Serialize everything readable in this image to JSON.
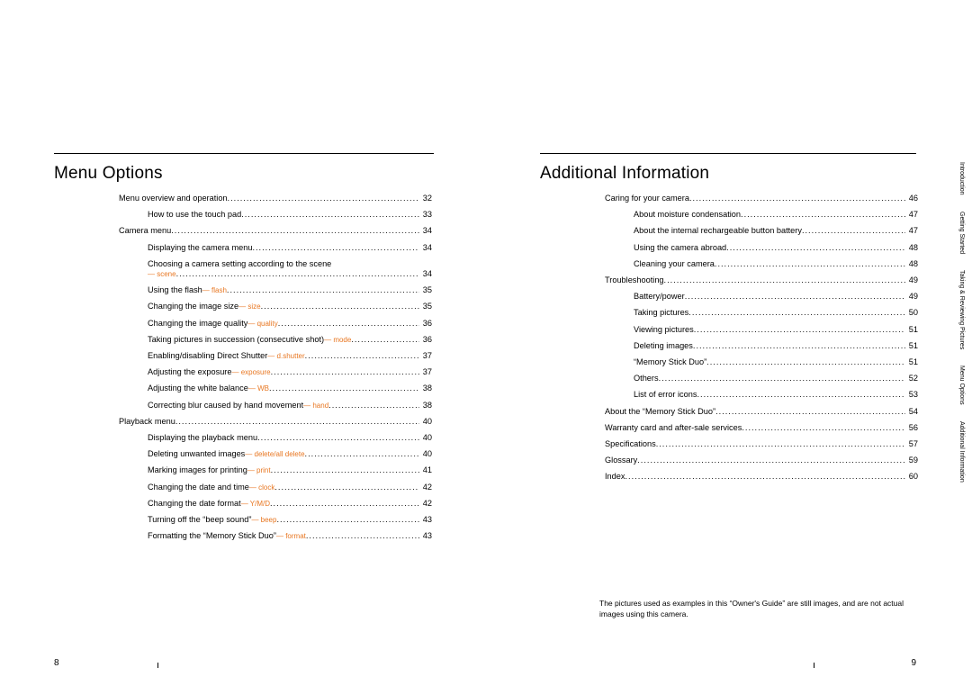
{
  "left": {
    "title": "Menu Options",
    "page_number": "8",
    "rows": [
      {
        "level": 0,
        "label": "Menu overview and operation",
        "tag": "",
        "page": "32"
      },
      {
        "level": 1,
        "label": "How to use the touch pad",
        "tag": "",
        "page": "33"
      },
      {
        "level": 0,
        "label": "Camera menu",
        "tag": "",
        "page": "34"
      },
      {
        "level": 1,
        "label": "Displaying the camera menu",
        "tag": "",
        "page": "34"
      },
      {
        "level": 1,
        "label": "Choosing a camera setting according to the scene",
        "tag": "",
        "page": "",
        "nowrap_continue": true
      },
      {
        "level": 1,
        "label": "",
        "tag": " — scene ",
        "page": "34",
        "tag_only": true
      },
      {
        "level": 1,
        "label": "Using the flash",
        "tag": " — flash",
        "page": "35"
      },
      {
        "level": 1,
        "label": "Changing the image size",
        "tag": " — size ",
        "page": "35"
      },
      {
        "level": 1,
        "label": "Changing the image quality",
        "tag": " — quality ",
        "page": "36"
      },
      {
        "level": 1,
        "label": "Taking pictures in succession (consecutive shot)",
        "tag": " — mode ",
        "page": "36"
      },
      {
        "level": 1,
        "label": "Enabling/disabling Direct Shutter",
        "tag": " — d.shutter",
        "page": "37"
      },
      {
        "level": 1,
        "label": "Adjusting the exposure",
        "tag": " — exposure ",
        "page": "37"
      },
      {
        "level": 1,
        "label": "Adjusting the white balance",
        "tag": " — WB ",
        "page": "38"
      },
      {
        "level": 1,
        "label": "Correcting blur caused by hand movement",
        "tag": " — hand ",
        "page": "38"
      },
      {
        "level": 0,
        "label": "Playback menu",
        "tag": "",
        "page": "40"
      },
      {
        "level": 1,
        "label": "Displaying the playback menu",
        "tag": "",
        "page": "40"
      },
      {
        "level": 1,
        "label": "Deleting unwanted images",
        "tag": " — delete/all delete ",
        "page": "40"
      },
      {
        "level": 1,
        "label": "Marking images for printing",
        "tag": " — print ",
        "page": "41"
      },
      {
        "level": 1,
        "label": "Changing the date and time",
        "tag": " — clock ",
        "page": "42"
      },
      {
        "level": 1,
        "label": "Changing the date format",
        "tag": " — Y/M/D ",
        "page": "42"
      },
      {
        "level": 1,
        "label": "Turning off the “beep sound”",
        "tag": " — beep ",
        "page": "43"
      },
      {
        "level": 1,
        "label": "Formatting the “Memory Stick Duo”",
        "tag": " — format ",
        "page": "43"
      }
    ]
  },
  "right": {
    "title": "Additional Information",
    "page_number": "9",
    "rows": [
      {
        "level": 0,
        "label": "Caring for your camera",
        "tag": "",
        "page": "46"
      },
      {
        "level": 1,
        "label": "About moisture condensation",
        "tag": "",
        "page": "47"
      },
      {
        "level": 1,
        "label": "About the internal rechargeable button battery",
        "tag": "",
        "page": "47"
      },
      {
        "level": 1,
        "label": "Using the camera abroad",
        "tag": "",
        "page": "48"
      },
      {
        "level": 1,
        "label": "Cleaning your camera",
        "tag": "",
        "page": "48"
      },
      {
        "level": 0,
        "label": "Troubleshooting",
        "tag": "",
        "page": "49"
      },
      {
        "level": 1,
        "label": "Battery/power",
        "tag": "",
        "page": "49"
      },
      {
        "level": 1,
        "label": "Taking pictures",
        "tag": "",
        "page": "50"
      },
      {
        "level": 1,
        "label": "Viewing pictures",
        "tag": "",
        "page": "51"
      },
      {
        "level": 1,
        "label": "Deleting images",
        "tag": "",
        "page": "51"
      },
      {
        "level": 1,
        "label": "“Memory Stick Duo”",
        "tag": "",
        "page": "51"
      },
      {
        "level": 1,
        "label": "Others",
        "tag": "",
        "page": "52"
      },
      {
        "level": 1,
        "label": "List of error icons",
        "tag": "",
        "page": "53"
      },
      {
        "level": 0,
        "label": "About the “Memory Stick Duo”",
        "tag": "",
        "page": "54"
      },
      {
        "level": 0,
        "label": "Warranty card and after-sale services",
        "tag": "",
        "page": "56"
      },
      {
        "level": 0,
        "label": "Specifications",
        "tag": "",
        "page": "57"
      },
      {
        "level": 0,
        "label": "Glossary",
        "tag": "",
        "page": "59"
      },
      {
        "level": 0,
        "label": "Index",
        "tag": "",
        "page": "60"
      }
    ],
    "note": "The pictures used as examples in this “Owner's Guide” are still images, and are not actual images using this camera."
  },
  "side_tabs": [
    "Introduction",
    "Getting Started",
    "Taking & Reviewing Pictures",
    "Menu Options",
    "Additional Information"
  ]
}
